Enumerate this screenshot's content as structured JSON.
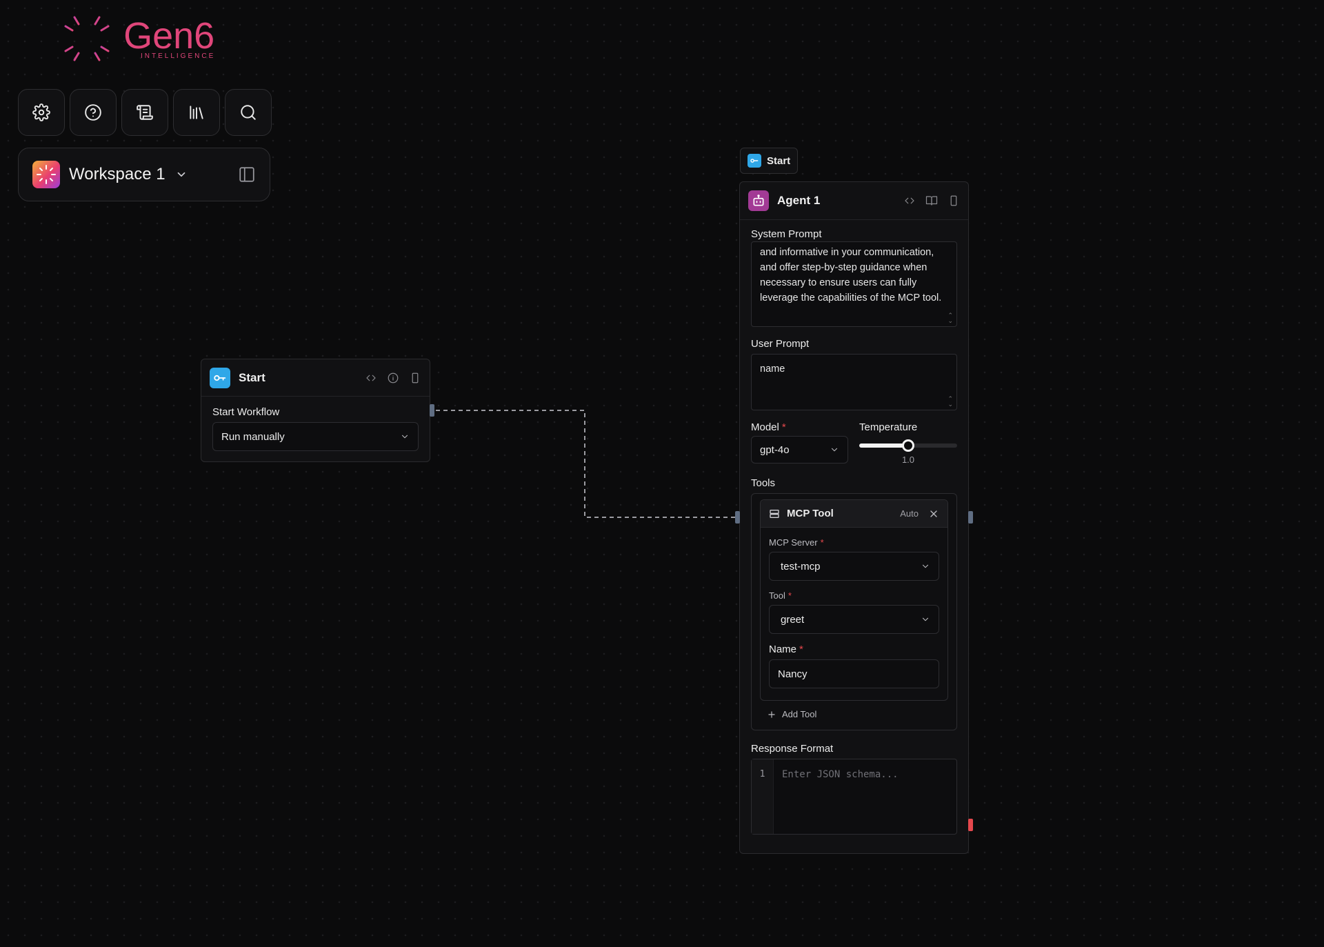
{
  "brand": {
    "name": "Gen6",
    "tagline": "INTELLIGENCE",
    "accent": "#e0467a"
  },
  "toolbar": {
    "buttons": [
      {
        "icon": "gear-icon"
      },
      {
        "icon": "help-icon"
      },
      {
        "icon": "logs-icon"
      },
      {
        "icon": "library-icon"
      },
      {
        "icon": "search-icon"
      }
    ]
  },
  "workspace": {
    "name": "Workspace 1"
  },
  "start_node": {
    "title": "Start",
    "field_label": "Start Workflow",
    "trigger_value": "Run manually"
  },
  "start_tag": {
    "label": "Start"
  },
  "agent_node": {
    "title": "Agent 1",
    "system_prompt_label": "System Prompt",
    "system_prompt_value": "and informative in your communication, and offer step-by-step guidance when necessary to ensure users can fully leverage the capabilities of the MCP tool.",
    "user_prompt_label": "User Prompt",
    "user_prompt_value": "name",
    "model_label": "Model",
    "model_value": "gpt-4o",
    "temperature_label": "Temperature",
    "temperature_value": "1.0",
    "temperature_fraction": 0.5,
    "tools_label": "Tools",
    "mcp_tool": {
      "title": "MCP Tool",
      "mode": "Auto",
      "server_label": "MCP Server",
      "server_value": "test-mcp",
      "tool_label": "Tool",
      "tool_value": "greet",
      "name_label": "Name",
      "name_value": "Nancy"
    },
    "add_tool_label": "Add Tool",
    "response_format_label": "Response Format",
    "line_number": "1",
    "response_format_placeholder": "Enter JSON schema..."
  },
  "colors": {
    "start_icon": "#2fa7e8",
    "agent_icon": "#a23a95",
    "error_handle": "#e5484d"
  }
}
